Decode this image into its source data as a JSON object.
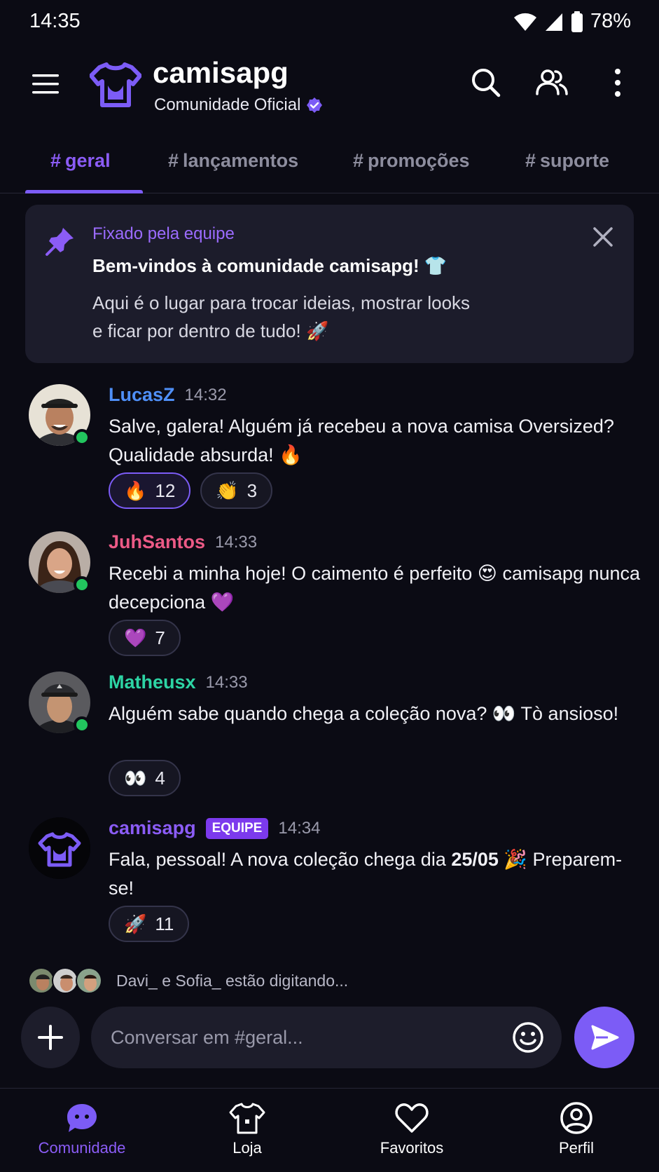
{
  "status_bar": {
    "time": "14:35",
    "battery": "78%"
  },
  "header": {
    "title": "camisapg",
    "subtitle": "Comunidade Oficial",
    "icons": [
      "menu-icon",
      "shirt-logo-icon",
      "verified-icon",
      "search-icon",
      "members-icon",
      "more-vertical-icon"
    ]
  },
  "tabs": [
    {
      "hash": "#",
      "label": "geral",
      "active": true
    },
    {
      "hash": "#",
      "label": "lançamentos",
      "active": false
    },
    {
      "hash": "#",
      "label": "promoções",
      "active": false
    },
    {
      "hash": "#",
      "label": "suporte",
      "active": false
    }
  ],
  "pinned": {
    "label": "Fixado pela equipe",
    "title": "Bem-vindos à comunidade camisapg! 👕",
    "body": "Aqui é o lugar para trocar ideias, mostrar looks e ficar por dentro de tudo! 🚀"
  },
  "messages": [
    {
      "user": "LucasZ",
      "time": "14:32",
      "user_color": "#4f8ff7",
      "text": "Salve, galera! Alguém já recebeu a nova camisa Oversized? Qualidade absurda! 🔥",
      "online": true,
      "reactions": [
        {
          "emoji": "🔥",
          "count": "12",
          "mine": true
        },
        {
          "emoji": "👏",
          "count": "3",
          "mine": false
        }
      ]
    },
    {
      "user": "JuhSantos",
      "time": "14:33",
      "user_color": "#ec5a86",
      "text": "Recebi a minha hoje! O caimento é perfeito 😍 camisapg nunca decepciona 💜",
      "online": true,
      "reactions": [
        {
          "emoji": "💜",
          "count": "7",
          "mine": false
        }
      ]
    },
    {
      "user": "Matheusx",
      "time": "14:33",
      "user_color": "#2dd4a4",
      "text": "Alguém sabe quando chega a coleção nova? 👀 Tò ansioso!",
      "online": true,
      "reactions": [
        {
          "emoji": "👀",
          "count": "4",
          "mine": false
        }
      ]
    },
    {
      "user": "camisapg",
      "time": "14:34",
      "user_color": "#8b5cf6",
      "badge": "EQUIPE",
      "text_before": "Fala, pessoal! A nova coleção chega dia ",
      "text_bold": "25/05",
      "text_after": " 🎉 Preparem-se!",
      "online": false,
      "reactions": [
        {
          "emoji": "🚀",
          "count": "11",
          "mine": false
        }
      ]
    }
  ],
  "typing": {
    "text": "Davi_ e Sofia_ estão digitando..."
  },
  "composer": {
    "placeholder": "Conversar em #geral...",
    "value": ""
  },
  "bottom_nav": [
    {
      "label": "Comunidade",
      "icon": "chat-bubble-icon",
      "active": true
    },
    {
      "label": "Loja",
      "icon": "shirt-icon",
      "active": false
    },
    {
      "label": "Favoritos",
      "icon": "heart-icon",
      "active": false
    },
    {
      "label": "Perfil",
      "icon": "profile-icon",
      "active": false
    }
  ],
  "colors": {
    "accent": "#7c5cf6",
    "online": "#22c55e",
    "background": "#0b0b14"
  }
}
